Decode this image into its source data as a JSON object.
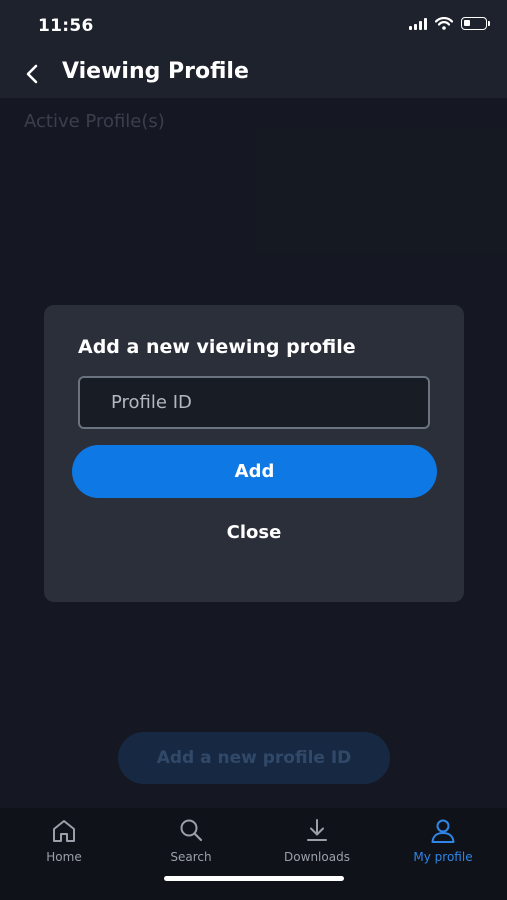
{
  "status_bar": {
    "time": "11:56"
  },
  "header": {
    "title": "Viewing Profile"
  },
  "content": {
    "section_label": "Active Profile(s)",
    "add_profile_id_label": "Add a new profile ID"
  },
  "dialog": {
    "title": "Add a new viewing profile",
    "input_placeholder": "Profile ID",
    "input_value": "",
    "add_label": "Add",
    "close_label": "Close"
  },
  "bottom_nav": {
    "items": [
      {
        "label": "Home",
        "icon": "home-icon",
        "active": false
      },
      {
        "label": "Search",
        "icon": "search-icon",
        "active": false
      },
      {
        "label": "Downloads",
        "icon": "download-icon",
        "active": false
      },
      {
        "label": "My profile",
        "icon": "person-icon",
        "active": true
      }
    ]
  },
  "colors": {
    "accent": "#0e78e4",
    "active_nav": "#2f86e8",
    "background": "#191d28",
    "dialog": "#2a2f39"
  }
}
